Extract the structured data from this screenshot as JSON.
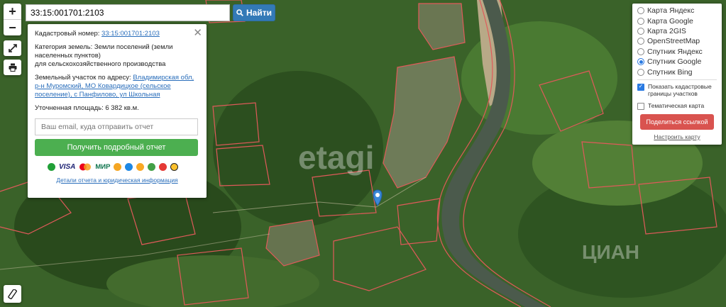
{
  "search": {
    "value": "33:15:001701:2103",
    "button_label": "Найти"
  },
  "zoom": {
    "in_label": "+",
    "out_label": "−"
  },
  "info": {
    "cad_label": "Кадастровый номер:",
    "cad_value": "33:15:001701:2103",
    "cat_label": "Категория земель:",
    "cat_value": "Земли поселений (земли населенных пунктов)",
    "cat_use": "для сельскохозяйственного производства",
    "addr_label": "Земельный участок по адресу:",
    "addr_value": "Владимирская обл, р-н Муромский, МО Ковардицкое (сельское поселение), с Панфилово, ул Школьная",
    "area_label": "Уточненная площадь:",
    "area_value": "6 382 кв.м.",
    "email_placeholder": "Ваш email, куда отправить отчет",
    "report_button": "Получить подробный отчет",
    "pay_visa": "VISA",
    "pay_mir": "МИР",
    "details_link": "Детали отчета и юридическая информация"
  },
  "layers": {
    "options": [
      {
        "label": "Карта Яндекс",
        "selected": false
      },
      {
        "label": "Карта Google",
        "selected": false
      },
      {
        "label": "Карта 2GIS",
        "selected": false
      },
      {
        "label": "OpenStreetMap",
        "selected": false
      },
      {
        "label": "Спутник Яндекс",
        "selected": false
      },
      {
        "label": "Спутник Google",
        "selected": true
      },
      {
        "label": "Спутник Bing",
        "selected": false
      }
    ],
    "show_borders": "Показать кадастровые границы участков",
    "show_borders_checked": true,
    "thematic": "Тематическая карта",
    "thematic_checked": false,
    "share_button": "Поделиться ссылкой",
    "setup_link": "Настроить карту"
  },
  "watermarks": {
    "etagi": "etagi",
    "cian": "ЦИАН"
  },
  "colors": {
    "accent": "#337ab7",
    "report": "#4caf50",
    "share": "#d9534f",
    "marker": "#3a88d6",
    "boundary": "#e05a5a",
    "river": "#4b5a4c"
  },
  "icons": {
    "zoom_in": "plus-icon",
    "zoom_out": "minus-icon",
    "fullscreen": "expand-icon",
    "print": "print-icon",
    "search": "search-icon",
    "close": "close-icon",
    "ruler": "ruler-icon",
    "marker": "location-pin-icon"
  }
}
